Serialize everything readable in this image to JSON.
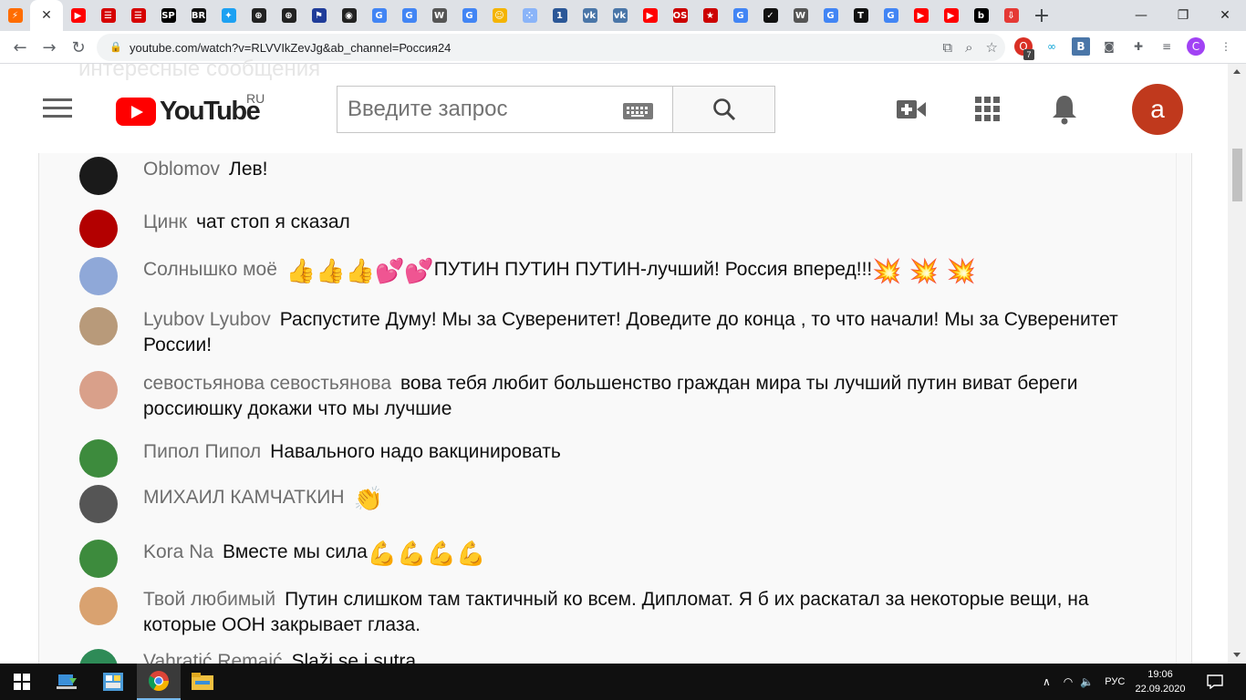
{
  "browser": {
    "tabs": [
      {
        "icon": "lightning-icon",
        "color": "#ff6d00",
        "glyph": "⚡"
      },
      {
        "icon": "close-icon",
        "active": true,
        "glyph": "✕"
      },
      {
        "icon": "youtube-icon",
        "color": "#ff0000",
        "glyph": "▶"
      },
      {
        "icon": "news-icon",
        "color": "#d60000",
        "glyph": "☰"
      },
      {
        "icon": "news-icon",
        "color": "#d60000",
        "glyph": "☰"
      },
      {
        "icon": "sp-icon",
        "color": "#000000",
        "glyph": "SP"
      },
      {
        "icon": "br-icon",
        "color": "#111111",
        "glyph": "BR"
      },
      {
        "icon": "twitter-icon",
        "color": "#1da1f2",
        "glyph": "✦"
      },
      {
        "icon": "globe-icon",
        "color": "#222222",
        "glyph": "⊕"
      },
      {
        "icon": "globe-icon",
        "color": "#222222",
        "glyph": "⊕"
      },
      {
        "icon": "flag-icon",
        "color": "#1f3c99",
        "glyph": "⚑"
      },
      {
        "icon": "compass-icon",
        "color": "#222222",
        "glyph": "◉"
      },
      {
        "icon": "google-icon",
        "color": "#4285f4",
        "glyph": "G"
      },
      {
        "icon": "google-icon",
        "color": "#4285f4",
        "glyph": "G"
      },
      {
        "icon": "wikipedia-icon",
        "color": "#555555",
        "glyph": "W"
      },
      {
        "icon": "google-icon",
        "color": "#4285f4",
        "glyph": "G"
      },
      {
        "icon": "smiley-icon",
        "color": "#f4b400",
        "glyph": "☺"
      },
      {
        "icon": "dots-icon",
        "color": "#8ab4f8",
        "glyph": "⁘"
      },
      {
        "icon": "number-icon",
        "color": "#2b5797",
        "glyph": "1"
      },
      {
        "icon": "vk-icon",
        "color": "#4a76a8",
        "glyph": "vk"
      },
      {
        "icon": "vk-icon",
        "color": "#4a76a8",
        "glyph": "vk"
      },
      {
        "icon": "youtube-icon",
        "color": "#ff0000",
        "glyph": "▶"
      },
      {
        "icon": "os-icon",
        "color": "#cc0000",
        "glyph": "OS"
      },
      {
        "icon": "star-icon",
        "color": "#cc0000",
        "glyph": "★"
      },
      {
        "icon": "google-icon",
        "color": "#4285f4",
        "glyph": "G"
      },
      {
        "icon": "nike-icon",
        "color": "#111111",
        "glyph": "✓"
      },
      {
        "icon": "wikipedia-icon",
        "color": "#555555",
        "glyph": "W"
      },
      {
        "icon": "google-icon",
        "color": "#4285f4",
        "glyph": "G"
      },
      {
        "icon": "nyt-icon",
        "color": "#111111",
        "glyph": "T"
      },
      {
        "icon": "google-icon",
        "color": "#4285f4",
        "glyph": "G"
      },
      {
        "icon": "youtube-icon",
        "color": "#ff0000",
        "glyph": "▶"
      },
      {
        "icon": "youtube-icon",
        "color": "#ff0000",
        "glyph": "▶"
      },
      {
        "icon": "b-icon",
        "color": "#000000",
        "glyph": "b"
      },
      {
        "icon": "download-icon",
        "color": "#e53935",
        "glyph": "⇩"
      }
    ],
    "url": "youtube.com/watch?v=RLVVIkZevJg&ab_channel=Россия24",
    "extension_badge": "7",
    "profile_letter": "C"
  },
  "youtube": {
    "region": "RU",
    "logo_text": "YouTube",
    "search_placeholder": "Введите запрос",
    "account_letter": "а",
    "ghost_text": "интересные сообщения"
  },
  "chat": {
    "messages": [
      {
        "author": "Oblomov",
        "text": "Лев!",
        "avatar": "#1a1a1a"
      },
      {
        "author": "Цинк",
        "text": "чат стоп я сказал",
        "avatar": "#b30000"
      },
      {
        "author": "Солнышко моё",
        "pre_emoji": "👍👍👍💕💕",
        "text": "ПУТИН ПУТИН ПУТИН-лучший! Россия вперед!!!",
        "post_emoji": "💥 💥 💥",
        "avatar": "#8fa8d8"
      },
      {
        "author": "Lyubov Lyubov",
        "text": "Распустите Думу! Мы за Суверенитет! Доведите до конца , то что начали! Мы за Суверенитет России!",
        "avatar": "#b89a7a"
      },
      {
        "author": "севостьянова севостьянова",
        "text": "вова тебя любит большенство граждан мира ты лучший путин виват береги россиюшку докажи что мы лучшие",
        "avatar": "#d9a08a"
      },
      {
        "author": "Пипол Пипол",
        "text": "Навального надо вакцинировать",
        "avatar": "#3d8b3d"
      },
      {
        "author": "МИХАИЛ КАМЧАТКИН",
        "text": "",
        "post_emoji": "👏",
        "avatar": "#555555"
      },
      {
        "author": "Kora Na",
        "text": "Вместе мы сила",
        "post_emoji": "💪💪💪💪",
        "avatar": "#3d8b3d"
      },
      {
        "author": "Твой любимый",
        "text": "Путин слишком там тактичный ко всем. Дипломат. Я б их раскатал за некоторые вещи, на которые ООН закрывает глаза.",
        "avatar": "#d9a270"
      },
      {
        "author": "Vahratić Remaić",
        "text": "Slaži se i sutra",
        "avatar": "#2e8b57"
      }
    ]
  },
  "taskbar": {
    "language": "РУС",
    "time": "19:06",
    "date": "22.09.2020"
  }
}
